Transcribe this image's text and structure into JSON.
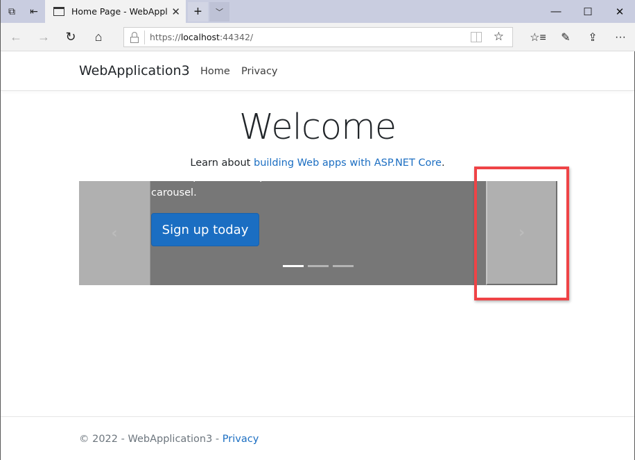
{
  "browser": {
    "tab": {
      "title": "Home Page - WebAppli",
      "close": "✕"
    },
    "new_tab": "+",
    "tab_menu": "﹀",
    "window_controls": {
      "minimize": "—",
      "maximize": "☐",
      "close": "✕"
    },
    "icons": {
      "set_aside": "⧉",
      "tabs_aside": "⇤",
      "back": "←",
      "forward": "→",
      "refresh": "↻",
      "home": "⌂",
      "favorite": "☆",
      "favorites_list": "☆≡",
      "notes": "✎",
      "share": "⇪",
      "more": "···"
    },
    "address": {
      "scheme": "https://",
      "host": "localhost",
      "port_path": ":44342/"
    }
  },
  "site": {
    "brand": "WebApplication3",
    "nav": [
      {
        "label": "Home"
      },
      {
        "label": "Privacy"
      }
    ],
    "welcome": "Welcome",
    "learn_prefix": "Learn about ",
    "learn_link": "building Web apps with ASP.NET Core",
    "learn_suffix": ".",
    "carousel": {
      "caption_hidden": "Some representative placeholder content for the first slide of the",
      "caption_visible": "carousel.",
      "button": "Sign up today",
      "prev_icon": "‹",
      "next_icon": "›",
      "slides": 3,
      "active_slide": 1
    },
    "footer": {
      "copyright": "© 2022 - WebApplication3 - ",
      "privacy_link": "Privacy"
    }
  },
  "annotation": {
    "highlight_color": "#ef4346",
    "target": "carousel-next-button"
  }
}
